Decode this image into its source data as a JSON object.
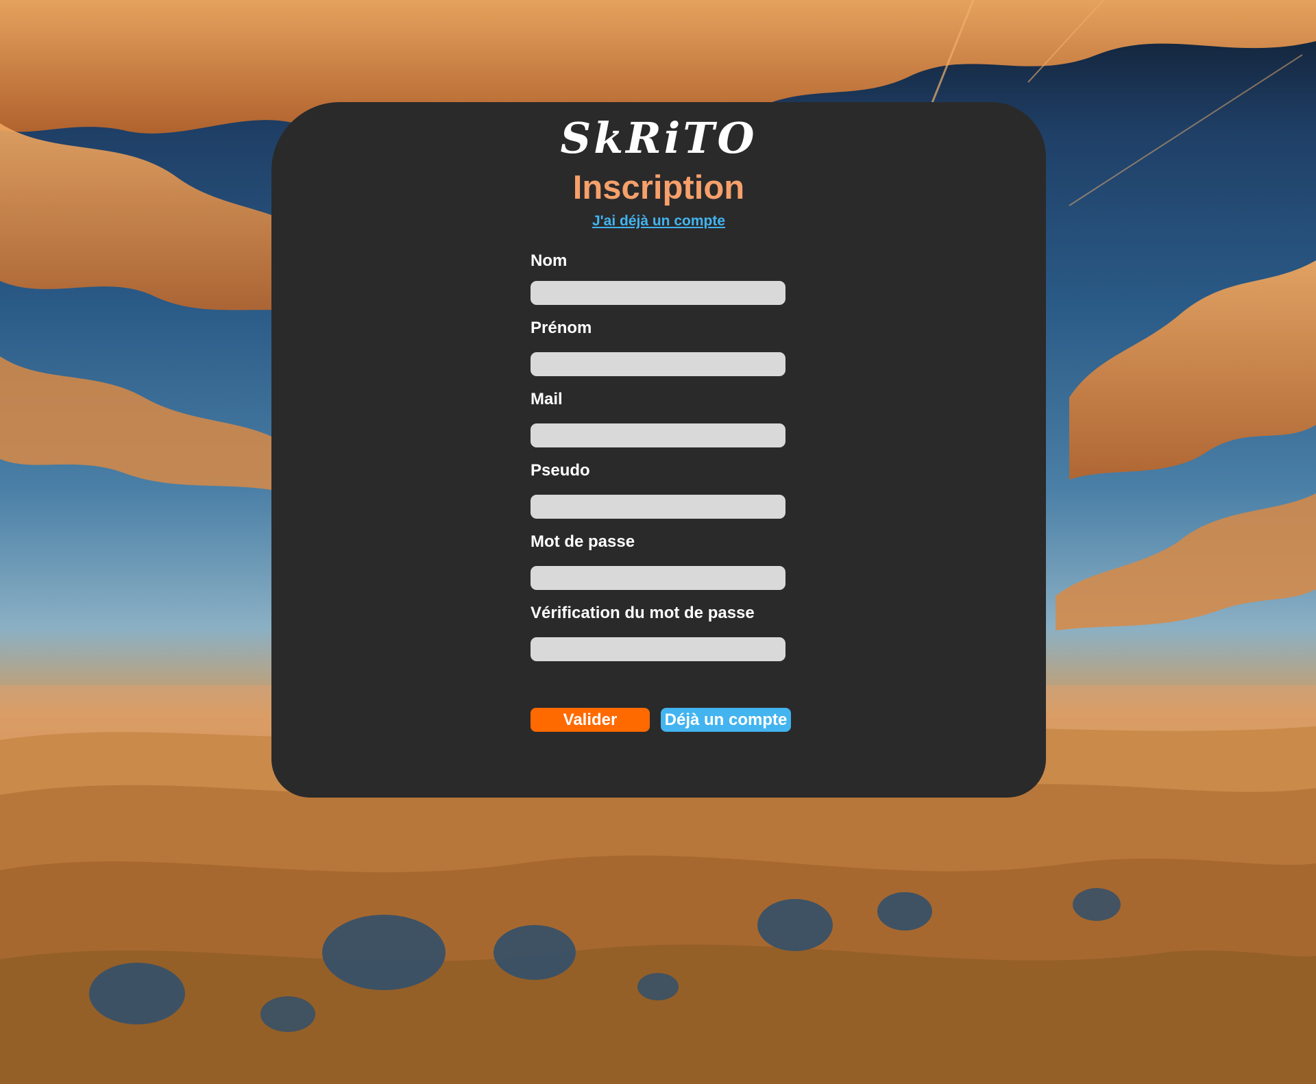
{
  "app": {
    "logo_text": "SkRiTO",
    "title": "Inscription",
    "login_link": "J'ai déjà un compte"
  },
  "form": {
    "fields": [
      {
        "label": "Nom",
        "value": "",
        "type": "text"
      },
      {
        "label": "Prénom",
        "value": "",
        "type": "text"
      },
      {
        "label": "Mail",
        "value": "",
        "type": "email"
      },
      {
        "label": "Pseudo",
        "value": "",
        "type": "text"
      },
      {
        "label": "Mot de passe",
        "value": "",
        "type": "password"
      },
      {
        "label": "Vérification du mot de passe",
        "value": "",
        "type": "password"
      }
    ],
    "submit_label": "Valider",
    "existing_account_label": "Déjà un compte"
  },
  "colors": {
    "card_bg": "#2a2a2a",
    "title": "#f6a06b",
    "link": "#43b4f0",
    "submit_button": "#ff6a00",
    "existing_button": "#43b4f0",
    "input_bg": "#d9d9d9"
  }
}
